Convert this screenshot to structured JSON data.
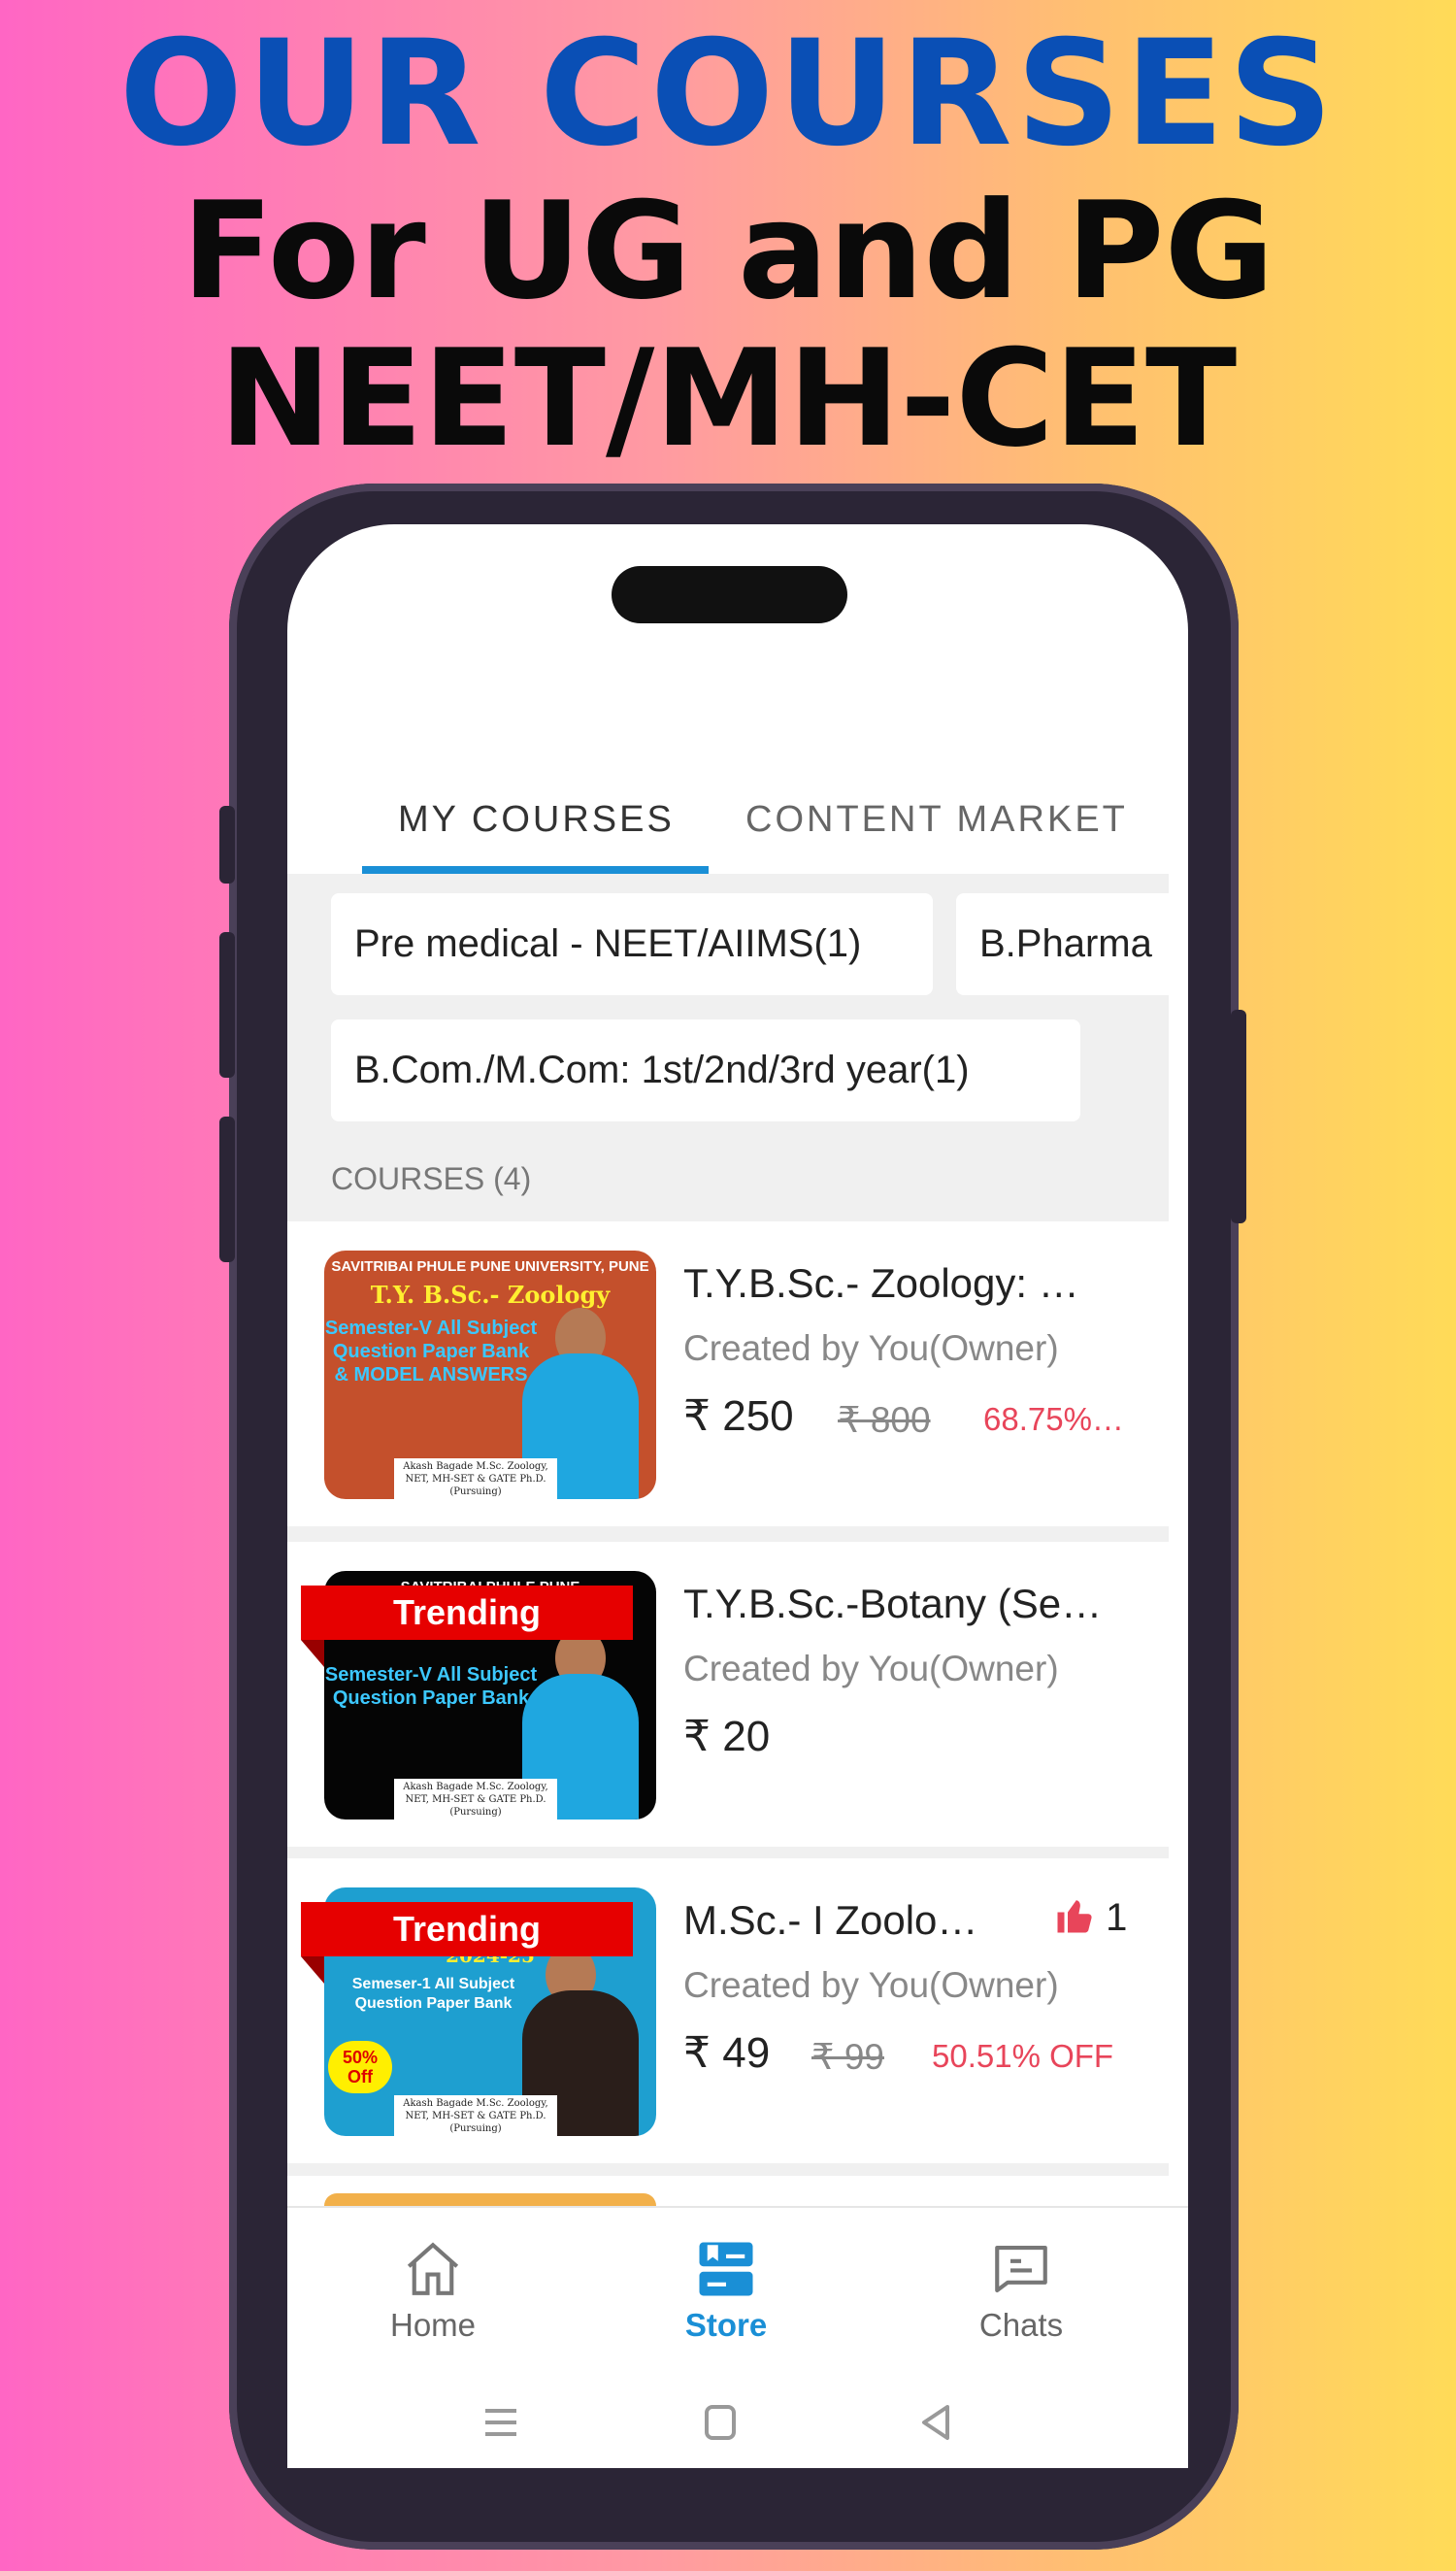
{
  "headline": {
    "line1": "OUR COURSES",
    "line2": "For UG and PG",
    "line3": "NEET/MH-CET"
  },
  "tabs": [
    {
      "label": "MY COURSES",
      "active": true
    },
    {
      "label": "CONTENT MARKET",
      "active": false
    }
  ],
  "chips": [
    "Pre medical - NEET/AIIMS(1)",
    "B.Pharma",
    "B.Com./M.Com: 1st/2nd/3rd year(1)"
  ],
  "section_label": "COURSES (4)",
  "courses": [
    {
      "title": "T.Y.B.Sc.- Zoology: …",
      "creator": "Created by You(Owner)",
      "price": "₹ 250",
      "old_price": "₹ 800",
      "discount": "68.75%…",
      "badge": "",
      "thumb": {
        "line1": "SAVITRIBAI PHULE PUNE UNIVERSITY, PUNE",
        "line2": "T.Y. B.Sc.- Zoology",
        "line3": "Semester-V All Subject Question Paper Bank & MODEL ANSWERS",
        "credit": "Akash Bagade M.Sc. Zoology, NET, MH-SET & GATE Ph.D. (Pursuing)",
        "bg": "#c4502c"
      }
    },
    {
      "title": "T.Y.B.Sc.-Botany (Se…",
      "creator": "Created by You(Owner)",
      "price": "₹ 20",
      "badge": "Trending",
      "thumb": {
        "line1": "SAVITRIBAI PHULE PUNE",
        "line2": "",
        "line3": "Semester-V All Subject Question Paper Bank",
        "credit": "Akash Bagade M.Sc. Zoology, NET, MH-SET & GATE Ph.D. (Pursuing)",
        "bg": "#050505"
      }
    },
    {
      "title": "M.Sc.- I Zoolo…",
      "creator": "Created by You(Owner)",
      "price": "₹ 49",
      "old_price": "₹ 99",
      "discount": "50.51% OFF",
      "badge": "Trending",
      "likes": "1",
      "thumb": {
        "line1": "",
        "line2": "2024-25",
        "line3": "Semeser-1 All Subject Question Paper Bank",
        "sticker": "50% Off",
        "credit": "Akash Bagade M.Sc. Zoology, NET, MH-SET & GATE Ph.D. (Pursuing)",
        "bg": "#1e9fd0"
      }
    }
  ],
  "bottom_nav": [
    {
      "label": "Home",
      "icon": "home-icon"
    },
    {
      "label": "Store",
      "icon": "store-icon",
      "active": true
    },
    {
      "label": "Chats",
      "icon": "chat-icon"
    }
  ],
  "colors": {
    "accent": "#1a8fd6",
    "discount": "#e8455a",
    "ribbon": "#e60000",
    "headline_blue": "#0a4fb5"
  }
}
